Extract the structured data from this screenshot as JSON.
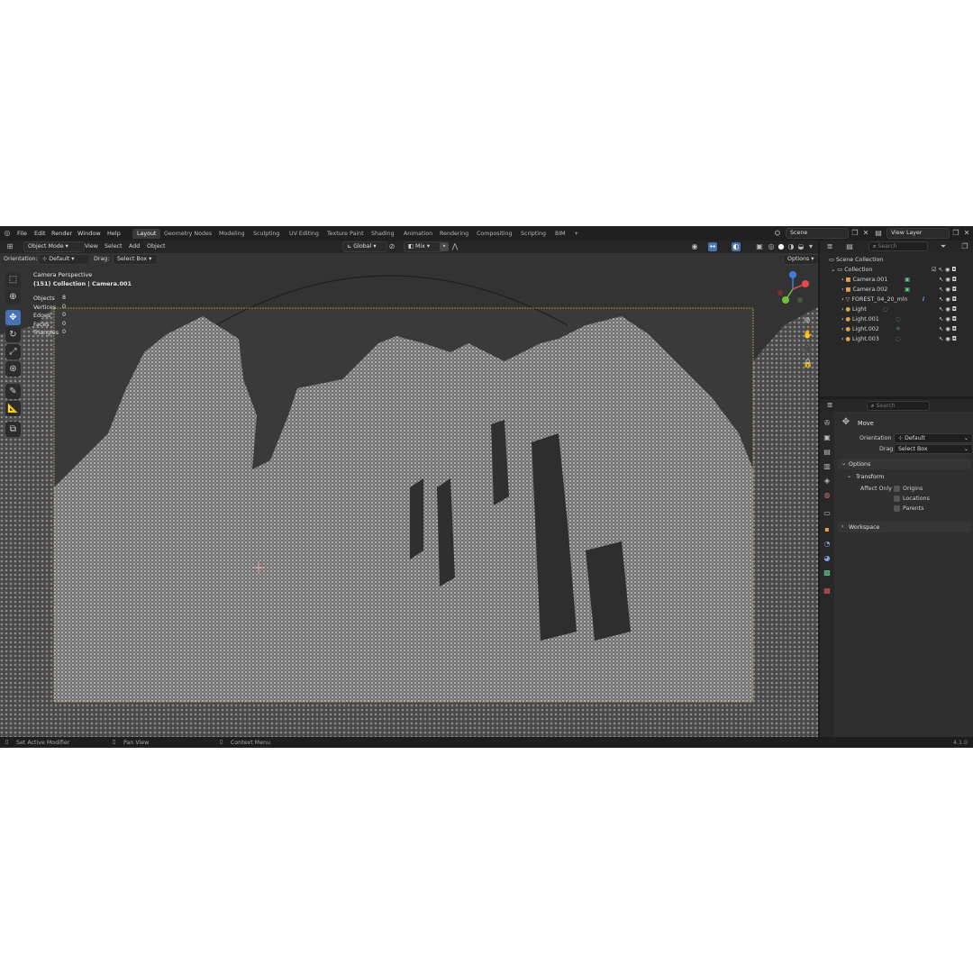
{
  "menus": [
    "File",
    "Edit",
    "Render",
    "Window",
    "Help"
  ],
  "workspaces": [
    "Layout",
    "Geometry Nodes",
    "Modeling",
    "Sculpting",
    "UV Editing",
    "Texture Paint",
    "Shading",
    "Animation",
    "Rendering",
    "Compositing",
    "Scripting",
    "BIM",
    "+"
  ],
  "active_workspace": "Layout",
  "scene": "Scene",
  "view_layer": "View Layer",
  "viewport_header": {
    "mode": "Object Mode",
    "menus": [
      "View",
      "Select",
      "Add",
      "Object"
    ],
    "transform_orientation": "Global",
    "blend": "Mix"
  },
  "tool_settings": {
    "orientation_label": "Orientation:",
    "orientation_value": "Default",
    "drag_label": "Drag:",
    "drag_value": "Select Box",
    "options": "Options"
  },
  "viewport": {
    "view_name": "Camera Perspective",
    "collection_info": "(151) Collection | Camera.001",
    "stats": [
      {
        "label": "Objects",
        "value": "8"
      },
      {
        "label": "Vertices",
        "value": "0"
      },
      {
        "label": "Edges",
        "value": "0"
      },
      {
        "label": "Faces",
        "value": "0"
      },
      {
        "label": "Triangles",
        "value": "0"
      }
    ]
  },
  "outliner": {
    "search_placeholder": "Search",
    "scene_collection": "Scene Collection",
    "collection": "Collection",
    "items": [
      "Camera.001",
      "Camera.002",
      "FOREST_04_20_mln",
      "Light",
      "Light.001",
      "Light.002",
      "Light.003"
    ]
  },
  "properties": {
    "search_placeholder": "Search",
    "tool_name": "Move",
    "orientation_label": "Orientation",
    "orientation_value": "Default",
    "drag_label": "Drag:",
    "drag_value": "Select Box",
    "options_header": "Options",
    "transform_header": "Transform",
    "affect_only_label": "Affect Only",
    "checkboxes": [
      "Origins",
      "Locations",
      "Parents"
    ],
    "workspace_header": "Workspace"
  },
  "statusbar": {
    "hints": [
      "Set Active Modifier",
      "Pan View",
      "Context Menu"
    ],
    "version": "4.1.0"
  },
  "colors": {
    "accent": "#4772b3",
    "camera_frame": "#c8a24a",
    "object_orange": "#e5a24b",
    "modifier_green": "#5fcf8a"
  }
}
